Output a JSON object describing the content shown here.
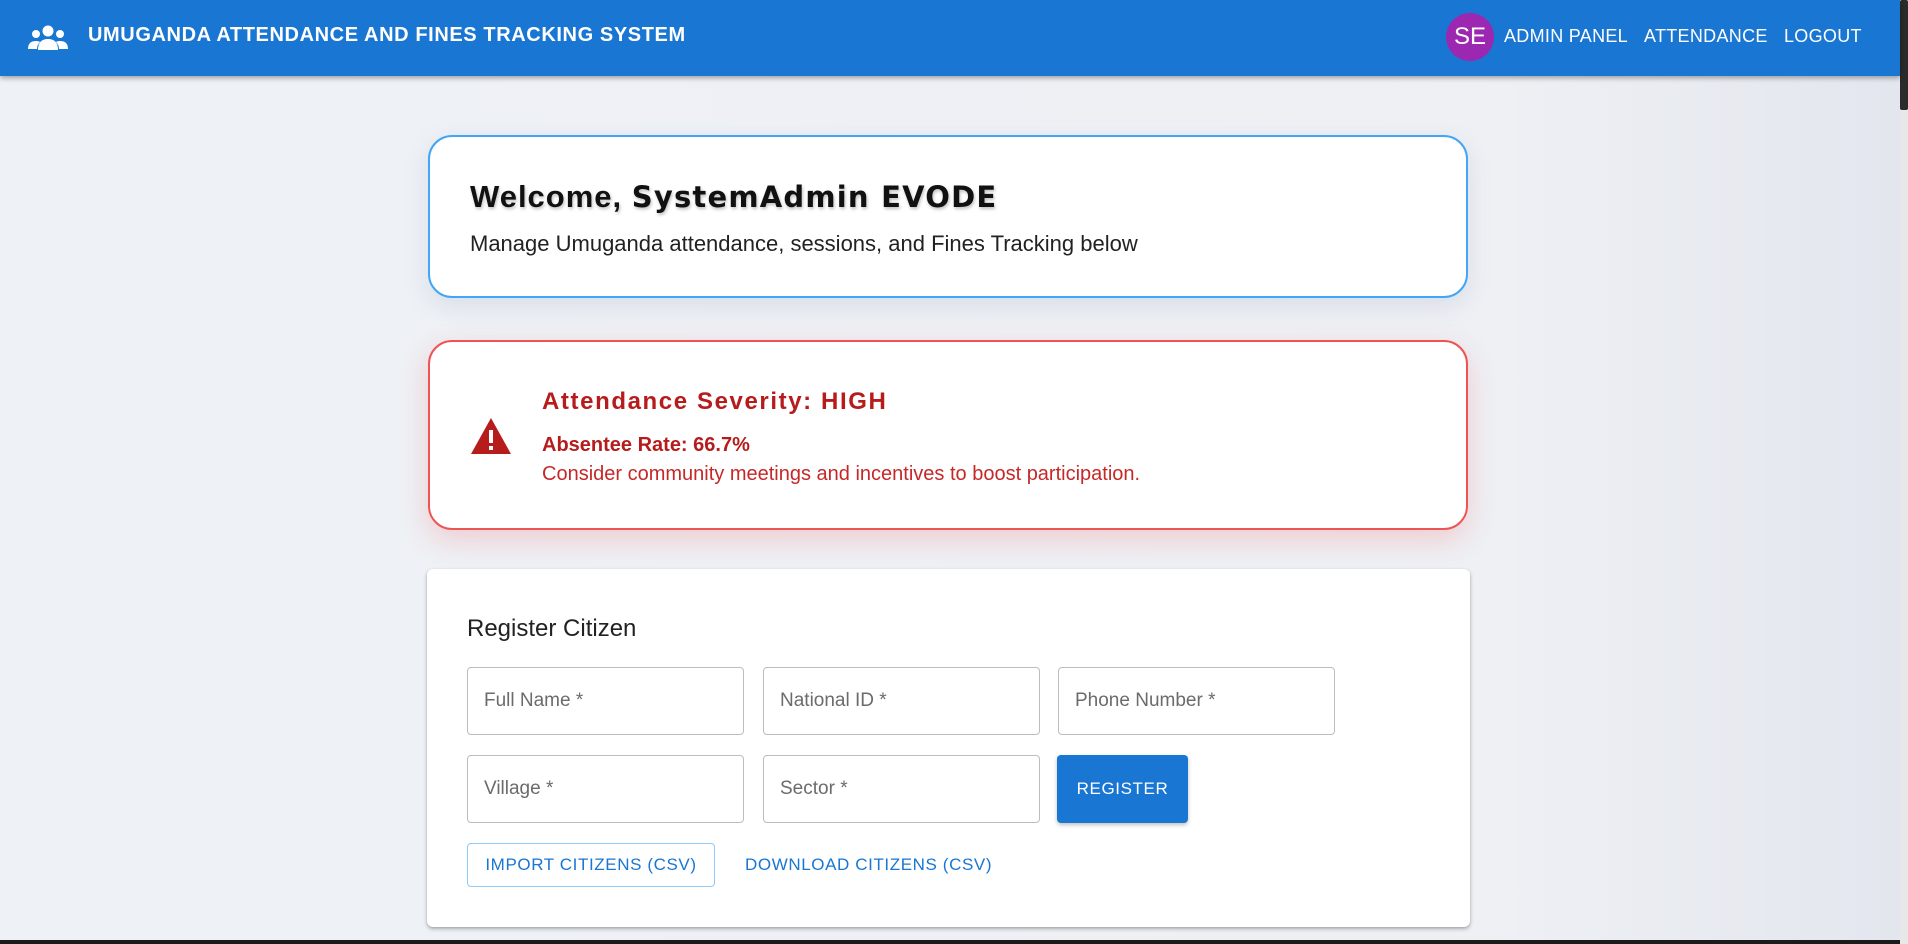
{
  "header": {
    "title": "UMUGANDA ATTENDANCE AND FINES TRACKING SYSTEM",
    "logo_icon": "people-group-icon",
    "avatar_initials": "SE",
    "avatar_color": "#9c27b0",
    "brand_color": "#1976d2",
    "nav": [
      {
        "label": "ADMIN PANEL"
      },
      {
        "label": "ATTENDANCE"
      },
      {
        "label": "LOGOUT"
      }
    ]
  },
  "welcome": {
    "prefix": "Welcome, ",
    "name": "SystemAdmin EVODE",
    "subtitle": "Manage Umuganda attendance, sessions, and Fines Tracking below"
  },
  "severity": {
    "icon": "warning-icon",
    "heading": "Attendance Severity: HIGH",
    "rate": "Absentee Rate: 66.7%",
    "advice": "Consider community meetings and incentives to boost participation.",
    "color": "#b71c1c"
  },
  "register": {
    "title": "Register Citizen",
    "fields": {
      "full_name": {
        "placeholder": "Full Name *",
        "value": ""
      },
      "national_id": {
        "placeholder": "National ID *",
        "value": ""
      },
      "phone": {
        "placeholder": "Phone Number *",
        "value": ""
      },
      "village": {
        "placeholder": "Village *",
        "value": ""
      },
      "sector": {
        "placeholder": "Sector *",
        "value": ""
      }
    },
    "register_label": "REGISTER",
    "import_label": "IMPORT CITIZENS (CSV)",
    "download_label": "DOWNLOAD CITIZENS (CSV)"
  }
}
